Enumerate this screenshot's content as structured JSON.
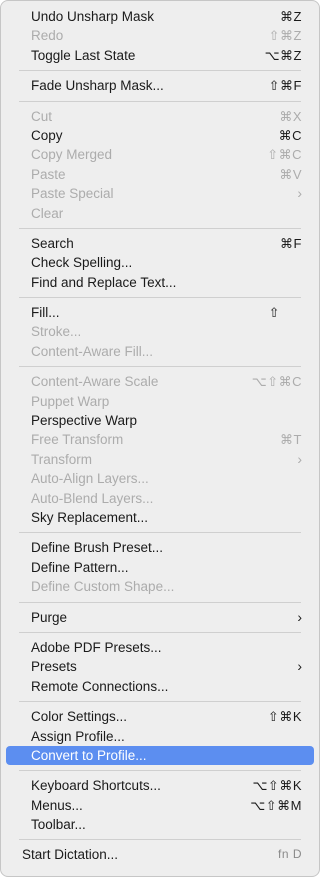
{
  "menu": {
    "items": [
      {
        "label": "Undo Unsharp Mask",
        "shortcut": "⌘Z",
        "enabled": true
      },
      {
        "label": "Redo",
        "shortcut": "⇧⌘Z",
        "enabled": false
      },
      {
        "label": "Toggle Last State",
        "shortcut": "⌥⌘Z",
        "enabled": true
      },
      {
        "label": "Fade Unsharp Mask...",
        "shortcut": "⇧⌘F",
        "enabled": true
      },
      {
        "label": "Cut",
        "shortcut": "⌘X",
        "enabled": false
      },
      {
        "label": "Copy",
        "shortcut": "⌘C",
        "enabled": true
      },
      {
        "label": "Copy Merged",
        "shortcut": "⇧⌘C",
        "enabled": false
      },
      {
        "label": "Paste",
        "shortcut": "⌘V",
        "enabled": false
      },
      {
        "label": "Paste Special",
        "arrow": "›",
        "enabled": false
      },
      {
        "label": "Clear",
        "enabled": false
      },
      {
        "label": "Search",
        "shortcut": "⌘F",
        "enabled": true
      },
      {
        "label": "Check Spelling...",
        "enabled": true
      },
      {
        "label": "Find and Replace Text...",
        "enabled": true
      },
      {
        "label": "Fill...",
        "shortcut": "⇧",
        "enabled": true
      },
      {
        "label": "Stroke...",
        "enabled": false
      },
      {
        "label": "Content-Aware Fill...",
        "enabled": false
      },
      {
        "label": "Content-Aware Scale",
        "shortcut": "⌥⇧⌘C",
        "enabled": false
      },
      {
        "label": "Puppet Warp",
        "enabled": false
      },
      {
        "label": "Perspective Warp",
        "enabled": true
      },
      {
        "label": "Free Transform",
        "shortcut": "⌘T",
        "enabled": false
      },
      {
        "label": "Transform",
        "arrow": "›",
        "enabled": false
      },
      {
        "label": "Auto-Align Layers...",
        "enabled": false
      },
      {
        "label": "Auto-Blend Layers...",
        "enabled": false
      },
      {
        "label": "Sky Replacement...",
        "enabled": true
      },
      {
        "label": "Define Brush Preset...",
        "enabled": true
      },
      {
        "label": "Define Pattern...",
        "enabled": true
      },
      {
        "label": "Define Custom Shape...",
        "enabled": false
      },
      {
        "label": "Purge",
        "arrow": "›",
        "enabled": true
      },
      {
        "label": "Adobe PDF Presets...",
        "enabled": true
      },
      {
        "label": "Presets",
        "arrow": "›",
        "enabled": true
      },
      {
        "label": "Remote Connections...",
        "enabled": true
      },
      {
        "label": "Color Settings...",
        "shortcut": "⇧⌘K",
        "enabled": true
      },
      {
        "label": "Assign Profile...",
        "enabled": true
      },
      {
        "label": "Convert to Profile...",
        "enabled": true,
        "highlighted": true
      },
      {
        "label": "Keyboard Shortcuts...",
        "shortcut": "⌥⇧⌘K",
        "enabled": true
      },
      {
        "label": "Menus...",
        "shortcut": "⌥⇧⌘M",
        "enabled": true
      },
      {
        "label": "Toolbar...",
        "enabled": true
      },
      {
        "label": "Start Dictation...",
        "shortcut": "fn D",
        "enabled": true
      }
    ]
  },
  "colors": {
    "highlight": "#5c8ef0",
    "disabled_text": "#acacac",
    "menu_background": "#eeeeee"
  }
}
